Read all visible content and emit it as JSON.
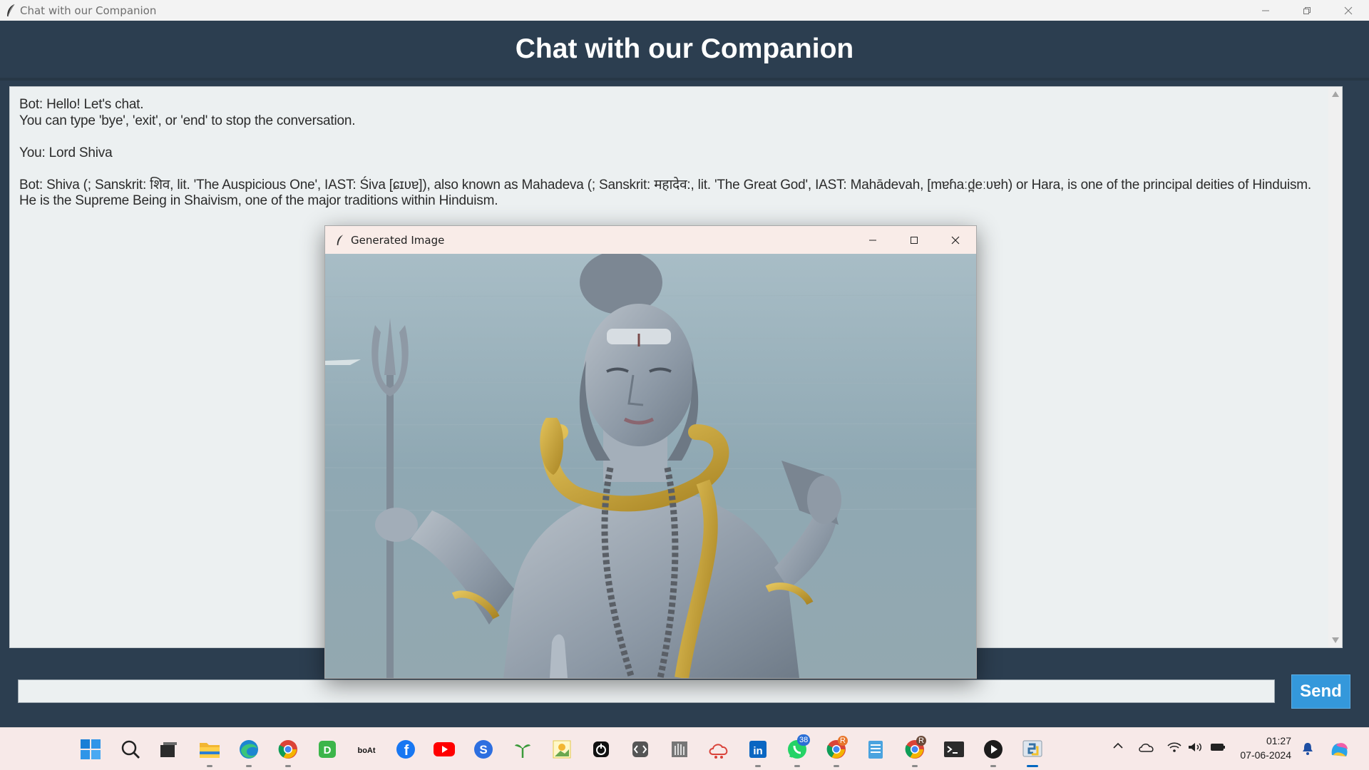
{
  "window": {
    "title": "Chat with our Companion"
  },
  "header": {
    "title": "Chat with our Companion"
  },
  "chat": {
    "messages": [
      "Bot: Hello! Let's chat.\nYou can type 'bye', 'exit', or 'end' to stop the conversation.",
      "You: Lord Shiva",
      "Bot: Shiva (; Sanskrit: शिव, lit. 'The Auspicious One', IAST: Śiva [ɕɪʋɐ]), also known as Mahadeva (; Sanskrit: महादेव:, lit. 'The Great God', IAST: Mahādevah, [mɐɦaːd̪eːʋɐh) or Hara, is one of the principal deities of Hinduism. He is the Supreme Being in Shaivism, one of the major traditions within Hinduism."
    ]
  },
  "input": {
    "value": "",
    "send_label": "Send"
  },
  "popup": {
    "title": "Generated Image",
    "image_subject": "Lord Shiva statue with trident, snake and damaru in front of the sea"
  },
  "taskbar": {
    "apps": [
      {
        "name": "start",
        "icon": "windows-logo-icon"
      },
      {
        "name": "search",
        "icon": "search-icon"
      },
      {
        "name": "task-view",
        "icon": "task-view-icon"
      },
      {
        "name": "file-explorer",
        "icon": "folder-icon"
      },
      {
        "name": "edge",
        "icon": "edge-icon"
      },
      {
        "name": "chrome",
        "icon": "chrome-icon"
      },
      {
        "name": "d-app",
        "icon": "d-app-icon",
        "label": "D"
      },
      {
        "name": "boat",
        "icon": "boat-icon",
        "label": "boAt"
      },
      {
        "name": "facebook",
        "icon": "facebook-icon",
        "label": "f"
      },
      {
        "name": "youtube",
        "icon": "youtube-icon"
      },
      {
        "name": "s-app",
        "icon": "s-app-icon",
        "label": "S"
      },
      {
        "name": "sprout",
        "icon": "sprout-icon"
      },
      {
        "name": "photo-app",
        "icon": "photo-app-icon"
      },
      {
        "name": "power-app",
        "icon": "power-app-icon"
      },
      {
        "name": "code-app",
        "icon": "code-app-icon"
      },
      {
        "name": "hand-app",
        "icon": "hand-app-icon"
      },
      {
        "name": "cloud-app",
        "icon": "cloud-app-icon"
      },
      {
        "name": "linkedin",
        "icon": "linkedin-icon",
        "label": "in"
      },
      {
        "name": "whatsapp",
        "icon": "whatsapp-icon",
        "badge": "38"
      },
      {
        "name": "chrome-profile-r",
        "icon": "chrome-icon",
        "badge": "R"
      },
      {
        "name": "notepad",
        "icon": "notepad-icon"
      },
      {
        "name": "chrome-profile-a",
        "icon": "chrome-icon",
        "badge": "R"
      },
      {
        "name": "terminal",
        "icon": "terminal-icon"
      },
      {
        "name": "media-player",
        "icon": "play-icon"
      },
      {
        "name": "python",
        "icon": "python-icon"
      }
    ],
    "clock_time": "01:27",
    "clock_date": "07-06-2024"
  },
  "colors": {
    "header_bg": "#2c3e50",
    "chat_bg": "#ecf0f1",
    "send_bg": "#3498db",
    "taskbar_bg": "#f7e9e8"
  }
}
